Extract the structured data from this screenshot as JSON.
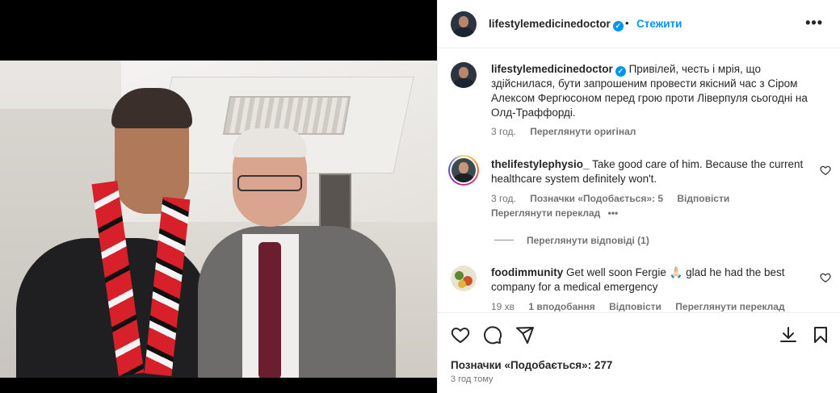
{
  "post": {
    "username": "lifestylemedicinedoctor",
    "verified_mark": "✓",
    "separator": "•",
    "follow_label": "Стежити",
    "more_label": "•••"
  },
  "caption": {
    "username": "lifestylemedicinedoctor",
    "text": "Привілей, честь і мрія, що здійснилася, бути запрошеним провести якісний час з Сіром Алексом Фергюсоном перед грою проти Ліверпуля сьогодні на Олд-Траффорді.",
    "time": "3 год.",
    "see_original": "Переглянути оригінал"
  },
  "comments": [
    {
      "username": "thelifestylephysio_",
      "text": "Take good care of him. Because the current healthcare system definitely won't.",
      "time": "3 год.",
      "likes": "Позначки «Подобається»: 5",
      "reply": "Відповісти",
      "translate": "Переглянути переклад",
      "more": "•••",
      "view_replies": "Переглянути відповіді (1)"
    },
    {
      "username": "foodimmunity",
      "text": "Get well soon Fergie 🙏🏻 glad he had the best company for a medical emergency",
      "time": "19 хв",
      "likes": "1 вподобання",
      "reply": "Відповісти",
      "translate": "Переглянути переклад"
    }
  ],
  "footer": {
    "likes": "Позначки «Подобається»: 277",
    "timestamp": "3 год тому"
  },
  "icons": [
    "heart-icon",
    "comment-icon",
    "share-icon",
    "download-icon",
    "bookmark-icon",
    "more-icon",
    "verified-icon"
  ],
  "colors": {
    "accent": "#0095f6",
    "text": "#262626",
    "muted": "#737373",
    "border": "#efefef"
  }
}
